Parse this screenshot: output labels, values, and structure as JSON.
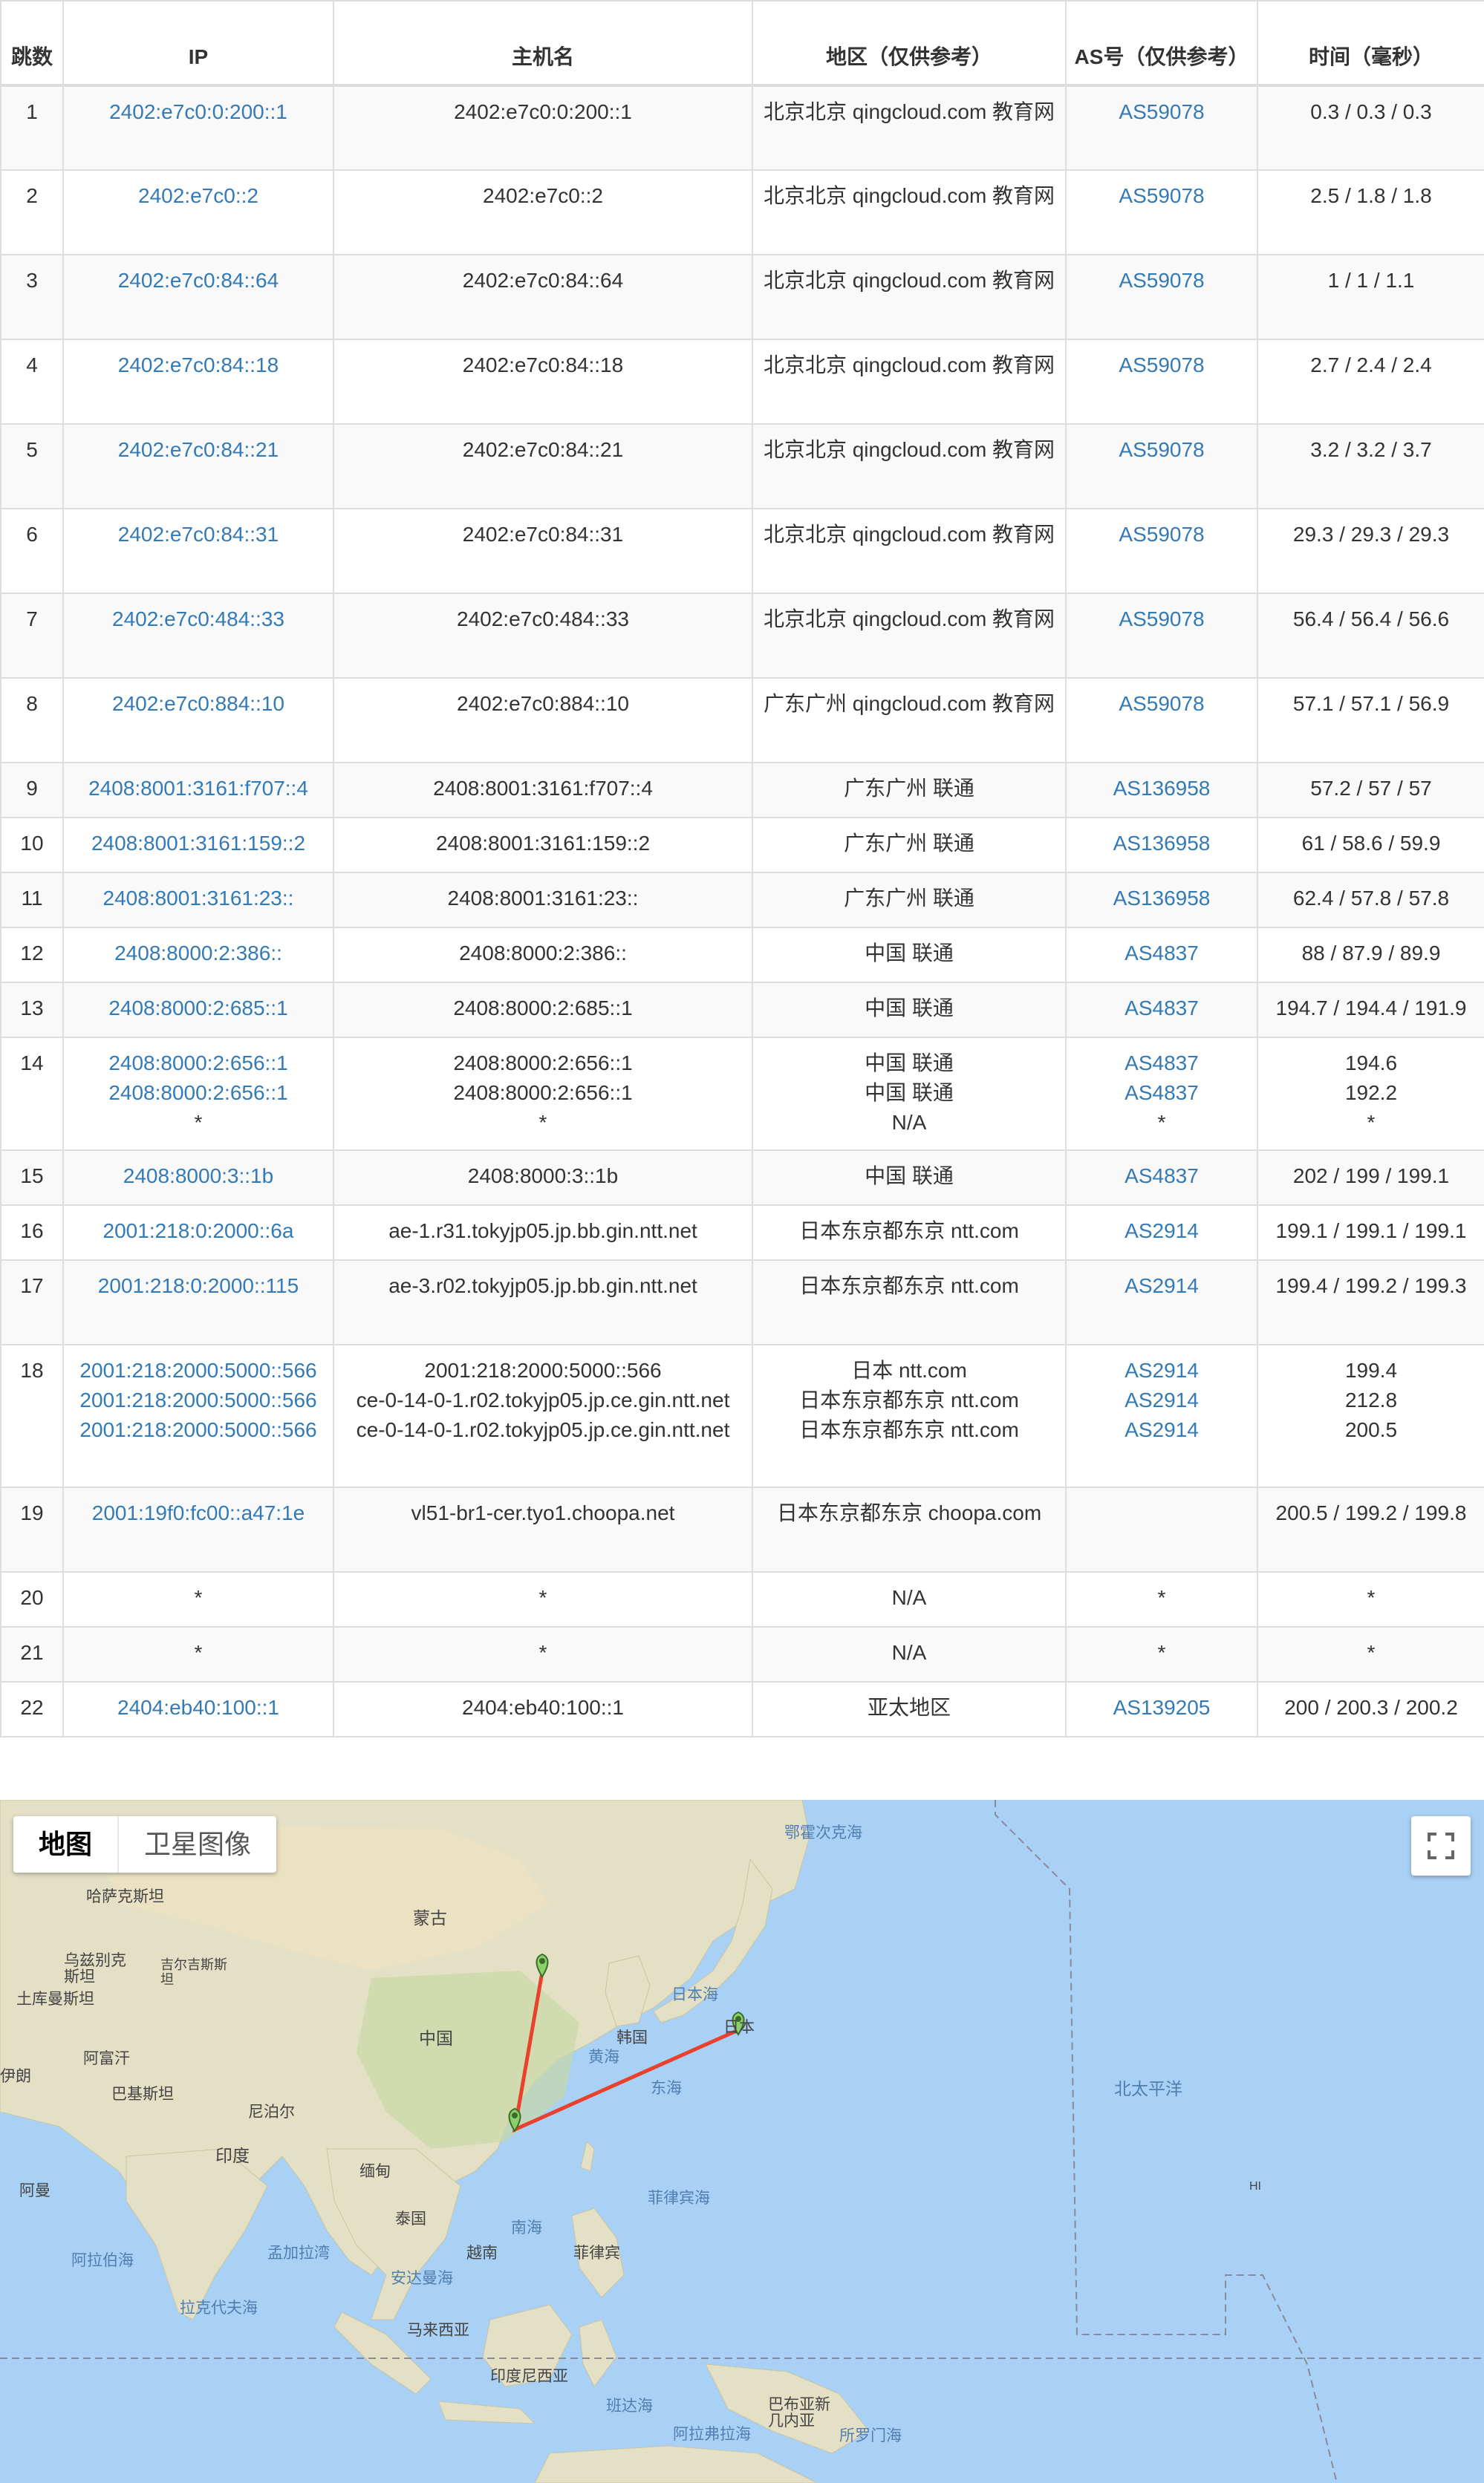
{
  "table": {
    "headers": {
      "hop": "跳数",
      "ip": "IP",
      "host": "主机名",
      "region": "地区（仅供参考）",
      "asn": "AS号（仅供参考）",
      "time": "时间（毫秒）"
    },
    "rows": [
      {
        "hop": "1",
        "ip": [
          "2402:e7c0:0:200::1"
        ],
        "host": [
          "2402:e7c0:0:200::1"
        ],
        "region": [
          "北京北京 qingcloud.com 教育网"
        ],
        "asn": [
          "AS59078"
        ],
        "time": [
          "0.3 / 0.3 / 0.3"
        ]
      },
      {
        "hop": "2",
        "ip": [
          "2402:e7c0::2"
        ],
        "host": [
          "2402:e7c0::2"
        ],
        "region": [
          "北京北京 qingcloud.com 教育网"
        ],
        "asn": [
          "AS59078"
        ],
        "time": [
          "2.5 / 1.8 / 1.8"
        ]
      },
      {
        "hop": "3",
        "ip": [
          "2402:e7c0:84::64"
        ],
        "host": [
          "2402:e7c0:84::64"
        ],
        "region": [
          "北京北京 qingcloud.com 教育网"
        ],
        "asn": [
          "AS59078"
        ],
        "time": [
          "1 / 1 / 1.1"
        ]
      },
      {
        "hop": "4",
        "ip": [
          "2402:e7c0:84::18"
        ],
        "host": [
          "2402:e7c0:84::18"
        ],
        "region": [
          "北京北京 qingcloud.com 教育网"
        ],
        "asn": [
          "AS59078"
        ],
        "time": [
          "2.7 / 2.4 / 2.4"
        ]
      },
      {
        "hop": "5",
        "ip": [
          "2402:e7c0:84::21"
        ],
        "host": [
          "2402:e7c0:84::21"
        ],
        "region": [
          "北京北京 qingcloud.com 教育网"
        ],
        "asn": [
          "AS59078"
        ],
        "time": [
          "3.2 / 3.2 / 3.7"
        ]
      },
      {
        "hop": "6",
        "ip": [
          "2402:e7c0:84::31"
        ],
        "host": [
          "2402:e7c0:84::31"
        ],
        "region": [
          "北京北京 qingcloud.com 教育网"
        ],
        "asn": [
          "AS59078"
        ],
        "time": [
          "29.3 / 29.3 / 29.3"
        ]
      },
      {
        "hop": "7",
        "ip": [
          "2402:e7c0:484::33"
        ],
        "host": [
          "2402:e7c0:484::33"
        ],
        "region": [
          "北京北京 qingcloud.com 教育网"
        ],
        "asn": [
          "AS59078"
        ],
        "time": [
          "56.4 / 56.4 / 56.6"
        ]
      },
      {
        "hop": "8",
        "ip": [
          "2402:e7c0:884::10"
        ],
        "host": [
          "2402:e7c0:884::10"
        ],
        "region": [
          "广东广州 qingcloud.com 教育网"
        ],
        "asn": [
          "AS59078"
        ],
        "time": [
          "57.1 / 57.1 / 56.9"
        ]
      },
      {
        "hop": "9",
        "ip": [
          "2408:8001:3161:f707::4"
        ],
        "host": [
          "2408:8001:3161:f707::4"
        ],
        "region": [
          "广东广州 联通"
        ],
        "asn": [
          "AS136958"
        ],
        "time": [
          "57.2 / 57 / 57"
        ]
      },
      {
        "hop": "10",
        "ip": [
          "2408:8001:3161:159::2"
        ],
        "host": [
          "2408:8001:3161:159::2"
        ],
        "region": [
          "广东广州 联通"
        ],
        "asn": [
          "AS136958"
        ],
        "time": [
          "61 / 58.6 / 59.9"
        ]
      },
      {
        "hop": "11",
        "ip": [
          "2408:8001:3161:23::"
        ],
        "host": [
          "2408:8001:3161:23::"
        ],
        "region": [
          "广东广州 联通"
        ],
        "asn": [
          "AS136958"
        ],
        "time": [
          "62.4 / 57.8 / 57.8"
        ]
      },
      {
        "hop": "12",
        "ip": [
          "2408:8000:2:386::"
        ],
        "host": [
          "2408:8000:2:386::"
        ],
        "region": [
          "中国 联通"
        ],
        "asn": [
          "AS4837"
        ],
        "time": [
          "88 / 87.9 / 89.9"
        ]
      },
      {
        "hop": "13",
        "ip": [
          "2408:8000:2:685::1"
        ],
        "host": [
          "2408:8000:2:685::1"
        ],
        "region": [
          "中国 联通"
        ],
        "asn": [
          "AS4837"
        ],
        "time": [
          "194.7 / 194.4 / 191.9"
        ]
      },
      {
        "hop": "14",
        "ip": [
          "2408:8000:2:656::1",
          "2408:8000:2:656::1",
          "*"
        ],
        "host": [
          "2408:8000:2:656::1",
          "2408:8000:2:656::1",
          "*"
        ],
        "region": [
          "中国 联通",
          "中国 联通",
          "N/A"
        ],
        "asn": [
          "AS4837",
          "AS4837",
          "*"
        ],
        "time": [
          "194.6",
          "192.2",
          "*"
        ]
      },
      {
        "hop": "15",
        "ip": [
          "2408:8000:3::1b"
        ],
        "host": [
          "2408:8000:3::1b"
        ],
        "region": [
          "中国 联通"
        ],
        "asn": [
          "AS4837"
        ],
        "time": [
          "202 / 199 / 199.1"
        ]
      },
      {
        "hop": "16",
        "ip": [
          "2001:218:0:2000::6a"
        ],
        "host": [
          "ae-1.r31.tokyjp05.jp.bb.gin.ntt.net"
        ],
        "region": [
          "日本东京都东京 ntt.com"
        ],
        "asn": [
          "AS2914"
        ],
        "time": [
          "199.1 / 199.1 / 199.1"
        ]
      },
      {
        "hop": "17",
        "ip": [
          "2001:218:0:2000::115"
        ],
        "host": [
          "ae-3.r02.tokyjp05.jp.bb.gin.ntt.net"
        ],
        "region": [
          "日本东京都东京 ntt.com"
        ],
        "asn": [
          "AS2914"
        ],
        "time": [
          "199.4 / 199.2 / 199.3"
        ]
      },
      {
        "hop": "18",
        "ip": [
          "2001:218:2000:5000::566",
          "2001:218:2000:5000::566",
          "2001:218:2000:5000::566"
        ],
        "host": [
          "2001:218:2000:5000::566",
          "ce-0-14-0-1.r02.tokyjp05.jp.ce.gin.ntt.net",
          "ce-0-14-0-1.r02.tokyjp05.jp.ce.gin.ntt.net"
        ],
        "region": [
          "日本 ntt.com",
          "日本东京都东京 ntt.com",
          "日本东京都东京 ntt.com"
        ],
        "asn": [
          "AS2914",
          "AS2914",
          "AS2914"
        ],
        "time": [
          "199.4",
          "212.8",
          "200.5"
        ]
      },
      {
        "hop": "19",
        "ip": [
          "2001:19f0:fc00::a47:1e"
        ],
        "host": [
          "vl51-br1-cer.tyo1.choopa.net"
        ],
        "region": [
          "日本东京都东京 choopa.com"
        ],
        "asn": [],
        "time": [
          "200.5 / 199.2 / 199.8"
        ]
      },
      {
        "hop": "20",
        "ip": [
          "*"
        ],
        "host": [
          "*"
        ],
        "region": [
          "N/A"
        ],
        "asn": [
          "*"
        ],
        "time": [
          "*"
        ]
      },
      {
        "hop": "21",
        "ip": [
          "*"
        ],
        "host": [
          "*"
        ],
        "region": [
          "N/A"
        ],
        "asn": [
          "*"
        ],
        "time": [
          "*"
        ]
      },
      {
        "hop": "22",
        "ip": [
          "2404:eb40:100::1"
        ],
        "host": [
          "2404:eb40:100::1"
        ],
        "region": [
          "亚太地区"
        ],
        "asn": [
          "AS139205"
        ],
        "time": [
          "200 / 200.3 / 200.2"
        ]
      }
    ]
  },
  "map": {
    "type_buttons": {
      "map": "地图",
      "satellite": "卫星图像"
    },
    "fullscreen_icon": "fullscreen-icon",
    "route_color": "#e8412c",
    "marker_color": "#8bd16a",
    "labels": {
      "okhotsk": "鄂霍次克海",
      "kazakhstan": "哈萨克斯坦",
      "mongolia": "蒙古",
      "uzbekistan": "乌兹别克斯坦",
      "kyrgyzstan": "吉尔吉斯斯坦",
      "turkmenistan": "土库曼斯坦",
      "japan_sea": "日本海",
      "japan": "日本",
      "korea": "韩国",
      "china": "中国",
      "yellow_sea": "黄海",
      "east_sea": "东海",
      "afghanistan": "阿富汗",
      "iran": "伊朗",
      "pakistan": "巴基斯坦",
      "nepal": "尼泊尔",
      "north_pacific": "北太平洋",
      "india": "印度",
      "myanmar": "缅甸",
      "oman": "阿曼",
      "philippine_sea": "菲律宾海",
      "hi": "HI",
      "thailand": "泰国",
      "south_sea": "南海",
      "arabian_sea": "阿拉伯海",
      "bay_of_bengal": "孟加拉湾",
      "vietnam": "越南",
      "philippines": "菲律宾",
      "andaman_sea": "安达曼海",
      "laccadive_sea": "拉克代夫海",
      "malaysia": "马来西亚",
      "indonesia": "印度尼西亚",
      "banda_sea": "班达海",
      "png": "巴布亚新几内亚",
      "arafura_sea": "阿拉弗拉海",
      "solomon_sea": "所罗门海"
    }
  }
}
